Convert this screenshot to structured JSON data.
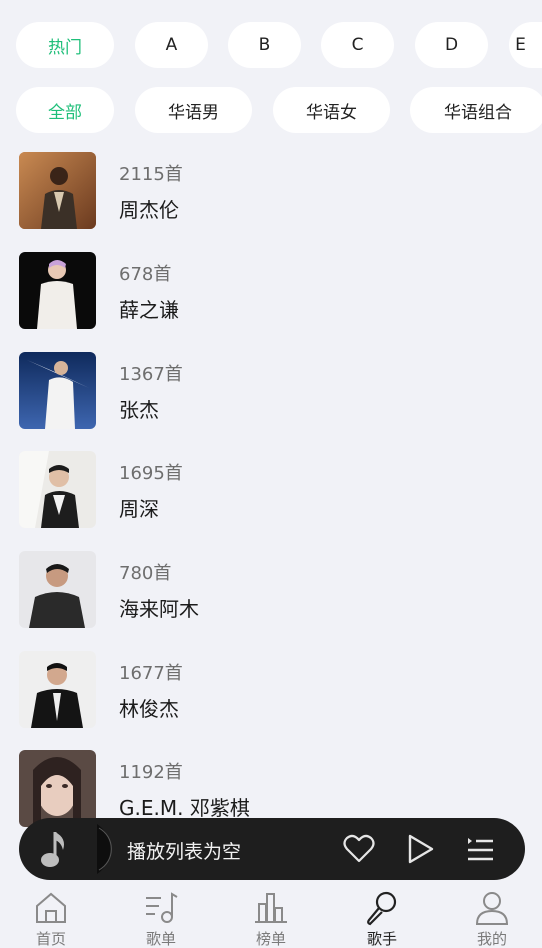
{
  "letter_filters": [
    "热门",
    "A",
    "B",
    "C",
    "D",
    "E"
  ],
  "category_filters": [
    "全部",
    "华语男",
    "华语女",
    "华语组合"
  ],
  "artists": [
    {
      "count": "2115首",
      "name": "周杰伦"
    },
    {
      "count": "678首",
      "name": "薛之谦"
    },
    {
      "count": "1367首",
      "name": "张杰"
    },
    {
      "count": "1695首",
      "name": "周深"
    },
    {
      "count": "780首",
      "name": "海来阿木"
    },
    {
      "count": "1677首",
      "name": "林俊杰"
    },
    {
      "count": "1192首",
      "name": "G.E.M. 邓紫棋"
    }
  ],
  "player": {
    "status": "播放列表为空",
    "icons": [
      "music-note-icon",
      "heart-icon",
      "play-icon",
      "playlist-icon"
    ]
  },
  "tabs": [
    {
      "label": "首页",
      "icon": "home-icon"
    },
    {
      "label": "歌单",
      "icon": "playlist-note-icon"
    },
    {
      "label": "榜单",
      "icon": "chart-icon"
    },
    {
      "label": "歌手",
      "icon": "microphone-icon"
    },
    {
      "label": "我的",
      "icon": "person-icon"
    }
  ],
  "colors": {
    "accent": "#1fbf7a",
    "background": "#f1f2f7",
    "player": "#1e1e1e"
  }
}
